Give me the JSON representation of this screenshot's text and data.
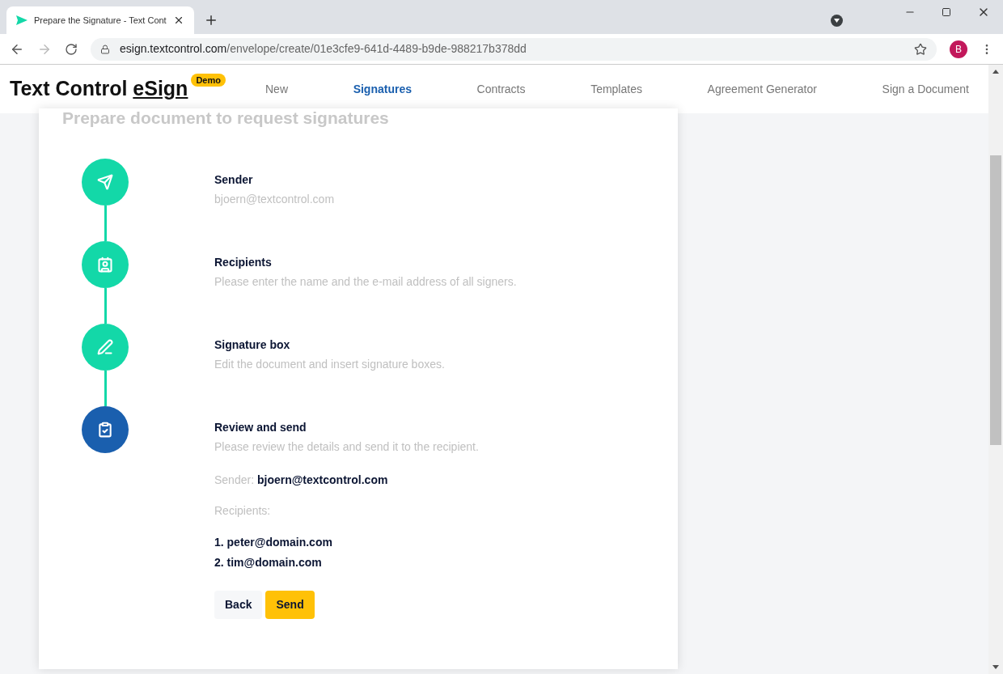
{
  "browser": {
    "tab_title": "Prepare the Signature - Text Cont",
    "url_host": "esign.textcontrol.com",
    "url_path": "/envelope/create/01e3cfe9-641d-4489-b9de-988217b378dd",
    "profile_initial": "B",
    "forward_disabled": true
  },
  "header": {
    "brand": "Text Control",
    "brand_product": "eSign",
    "badge": "Demo",
    "nav": [
      {
        "label": "New",
        "selected": false
      },
      {
        "label": "Signatures",
        "selected": true
      },
      {
        "label": "Contracts",
        "selected": false
      },
      {
        "label": "Templates",
        "selected": false
      },
      {
        "label": "Agreement Generator",
        "selected": false
      },
      {
        "label": "Sign a Document",
        "selected": false
      }
    ]
  },
  "page_title": "Prepare document to request signatures",
  "steps": [
    {
      "kind": "send",
      "current": false,
      "title": "Sender",
      "description": "bjoern@textcontrol.com"
    },
    {
      "kind": "contact",
      "current": false,
      "title": "Recipients",
      "description": "Please enter the name and the e-mail address of all signers."
    },
    {
      "kind": "edit",
      "current": false,
      "title": "Signature box",
      "description": "Edit the document and insert signature boxes."
    },
    {
      "kind": "review",
      "current": true,
      "title": "Review and send",
      "description": "Please review the details and send it to the recipient."
    }
  ],
  "review": {
    "sender_label": "Sender:",
    "sender_value": "bjoern@textcontrol.com",
    "recipients_label": "Recipients:",
    "recipients": [
      "1. peter@domain.com",
      "2. tim@domain.com"
    ]
  },
  "buttons": [
    {
      "kind": "secondary",
      "label": "Back"
    },
    {
      "kind": "primary",
      "label": "Send"
    }
  ]
}
